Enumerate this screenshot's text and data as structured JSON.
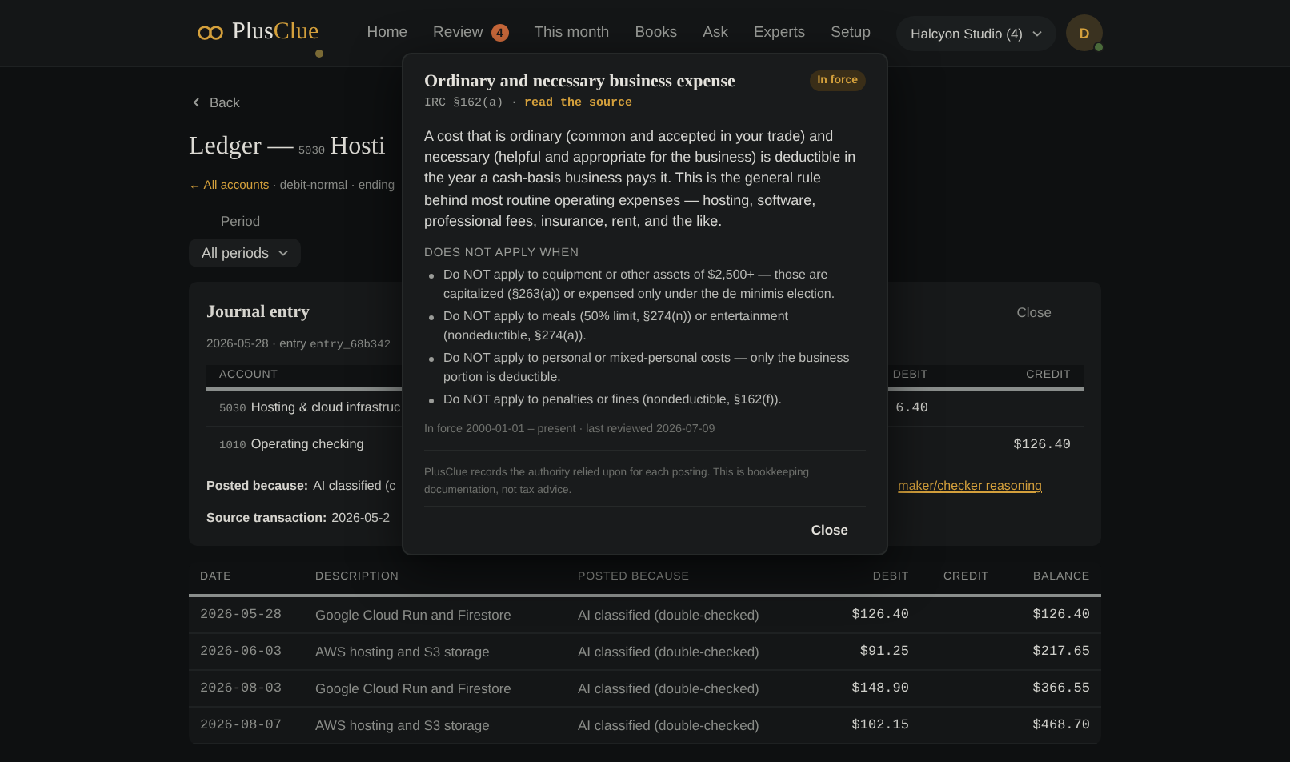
{
  "header": {
    "brand": {
      "part_1": "Plus",
      "part_2": "Clue"
    },
    "nav": [
      {
        "label": "Home"
      },
      {
        "label": "Review",
        "badge": "4"
      },
      {
        "label": "This month"
      },
      {
        "label": "Books"
      },
      {
        "label": "Ask"
      },
      {
        "label": "Experts"
      },
      {
        "label": "Setup"
      }
    ],
    "workspace": "Halcyon Studio (4)",
    "avatar": "D"
  },
  "back": "Back",
  "page_title": {
    "prefix": "Ledger —",
    "code": "5030",
    "name": "Hosti"
  },
  "subtitle": {
    "link": "← All accounts",
    "rest": "· debit-normal · ending"
  },
  "period": {
    "label": "Period",
    "value": "All periods"
  },
  "journal_entry": {
    "title": "Journal entry",
    "close": "Close",
    "date_line": "2026-05-28 · entry",
    "entry_id": "entry_68b342",
    "columns": [
      "ACCOUNT",
      "DEBIT",
      "CREDIT"
    ],
    "lines": [
      {
        "code": "5030",
        "name": "Hosting & cloud infrastruc",
        "debit": "6.40"
      },
      {
        "code": "1010",
        "name": "Operating checking",
        "credit": "$126.40"
      }
    ],
    "posted": {
      "label": "Posted because:",
      "value": "AI classified (c",
      "link": "maker/checker reasoning"
    },
    "source": {
      "label": "Source transaction:",
      "value": "2026-05-2"
    }
  },
  "ledger": {
    "columns": [
      "DATE",
      "DESCRIPTION",
      "POSTED BECAUSE",
      "DEBIT",
      "CREDIT",
      "BALANCE"
    ],
    "rows": [
      {
        "date": "2026-05-28",
        "description": "Google Cloud Run and Firestore",
        "posted_because": "AI classified (double-checked)",
        "debit": "$126.40",
        "balance": "$126.40"
      },
      {
        "date": "2026-06-03",
        "description": "AWS hosting and S3 storage",
        "posted_because": "AI classified (double-checked)",
        "debit": "$91.25",
        "balance": "$217.65"
      },
      {
        "date": "2026-08-03",
        "description": "Google Cloud Run and Firestore",
        "posted_because": "AI classified (double-checked)",
        "debit": "$148.90",
        "balance": "$366.55"
      },
      {
        "date": "2026-08-07",
        "description": "AWS hosting and S3 storage",
        "posted_because": "AI classified (double-checked)",
        "debit": "$102.15",
        "balance": "$468.70"
      }
    ]
  },
  "popover": {
    "title": "Ordinary and necessary business expense",
    "status": "In force",
    "citation": "IRC §162(a) ·",
    "source_link": "read the source",
    "description": "A cost that is ordinary (common and accepted in your trade) and necessary (helpful and appropriate for the business) is deductible in the year a cash-basis business pays it. This is the general rule behind most routine operating expenses — hosting, software, professional fees, insurance, rent, and the like.",
    "exclusions_heading": "DOES NOT APPLY WHEN",
    "exclusions": [
      "Do NOT apply to equipment or other assets of $2,500+ — those are capitalized (§263(a)) or expensed only under the de minimis election.",
      "Do NOT apply to meals (50% limit, §274(n)) or entertainment (nondeductible, §274(a)).",
      "Do NOT apply to personal or mixed-personal costs — only the business portion is deductible.",
      "Do NOT apply to penalties or fines (nondeductible, §162(f))."
    ],
    "in_force": "In force 2000-01-01 – present · last reviewed 2026-07-09",
    "disclaimer": "PlusClue records the authority relied upon for each posting. This is bookkeeping documentation, not tax advice.",
    "close": "Close"
  }
}
